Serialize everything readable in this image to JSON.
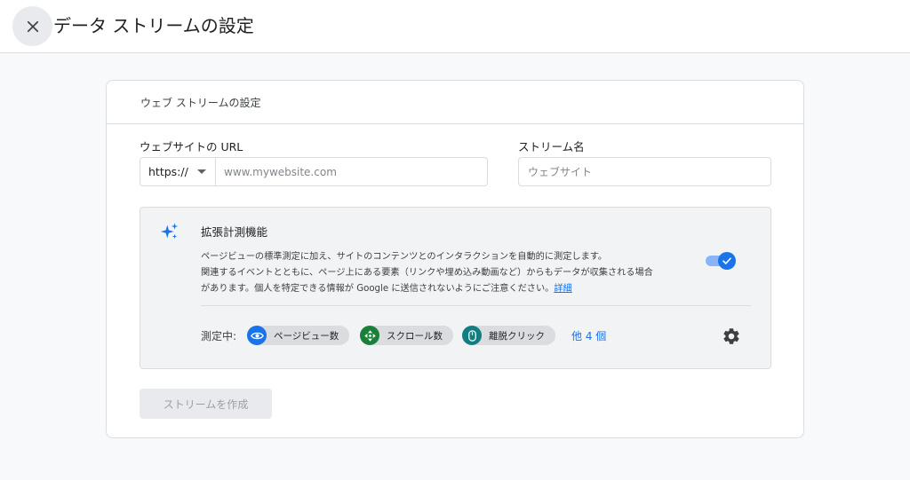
{
  "header": {
    "title": "データ ストリームの設定",
    "close_icon": "close-icon"
  },
  "card": {
    "header": "ウェブ ストリームの設定",
    "url_label": "ウェブサイトの URL",
    "protocol_value": "https://",
    "url_placeholder": "www.mywebsite.com",
    "url_value": "",
    "stream_name_label": "ストリーム名",
    "stream_name_placeholder": "ウェブサイト",
    "stream_name_value": ""
  },
  "enhanced_measurement": {
    "icon": "sparkle-icon",
    "title": "拡張計測機能",
    "description_line1": "ページビューの標準測定に加え、サイトのコンテンツとのインタラクションを自動的に測定します。",
    "description_line2": "関連するイベントとともに、ページ上にある要素（リンクや埋め込み動画など）からもデータが収集される場合",
    "description_line3": "があります。個人を特定できる情報が Google に送信されないようにご注意ください。",
    "details_link": "詳細",
    "toggle_on": true,
    "measuring_label": "測定中:",
    "chips": [
      {
        "label": "ページビュー数",
        "icon": "eye-icon",
        "color": "#1a73e8"
      },
      {
        "label": "スクロール数",
        "icon": "scroll-icon",
        "color": "#188038"
      },
      {
        "label": "離脱クリック",
        "icon": "mouse-icon",
        "color": "#137d81"
      }
    ],
    "more_link": "他 4 個",
    "settings_icon": "gear-icon"
  },
  "actions": {
    "create_button": "ストリームを作成"
  },
  "colors": {
    "accent": "#1a73e8",
    "disabled_text": "#9aa0a6",
    "background": "#f8f9fa"
  }
}
